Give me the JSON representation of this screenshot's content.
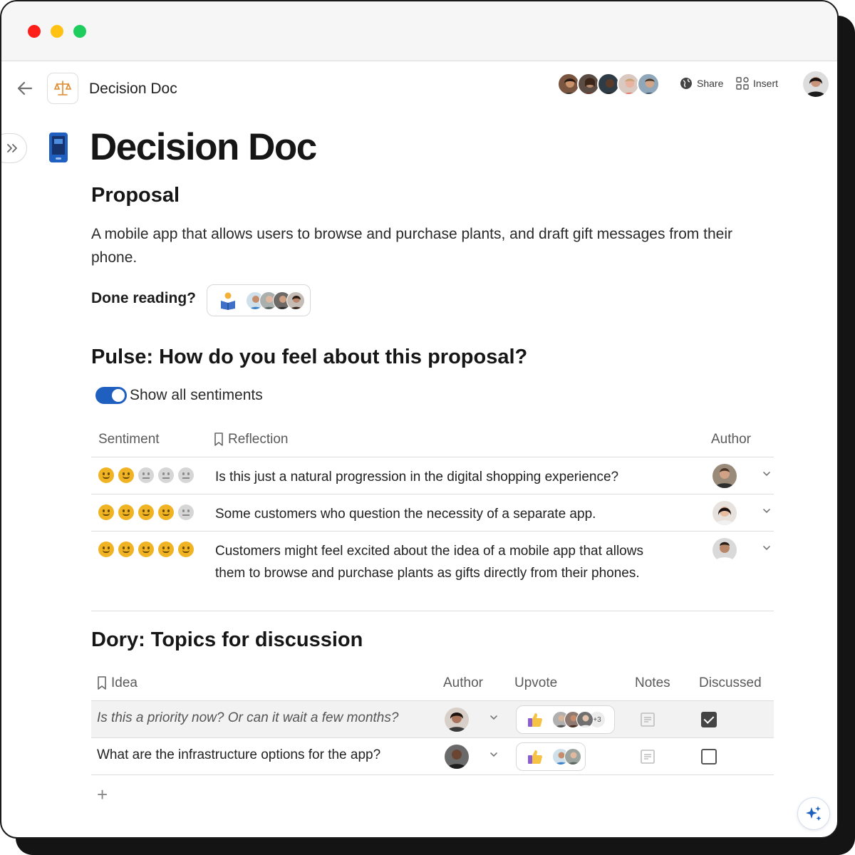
{
  "app": {
    "doc_name": "Decision Doc"
  },
  "toolbar": {
    "share_label": "Share",
    "insert_label": "Insert"
  },
  "colors": {
    "accent": "#1f5fbf",
    "sentiment_on": "#f0b323",
    "sentiment_off": "#d6d6d6",
    "highlight_row": "#f2f2f2"
  },
  "page": {
    "title": "Decision Doc",
    "icon": "mobile-phone-icon"
  },
  "proposal": {
    "heading": "Proposal",
    "text": "A mobile app that allows users to browse and purchase plants, and draft gift messages from their phone.",
    "done_label": "Done reading?"
  },
  "pulse": {
    "heading": "Pulse: How do you feel about this proposal?",
    "toggle_label": "Show all sentiments",
    "toggle_on": true,
    "columns": {
      "sentiment": "Sentiment",
      "reflection": "Reflection",
      "author": "Author"
    },
    "rows": [
      {
        "sentiment": 2,
        "reflection": "Is this just a natural progression in the digital shopping experience?"
      },
      {
        "sentiment": 4,
        "reflection": "Some customers who question the necessity of a separate app."
      },
      {
        "sentiment": 5,
        "reflection": "Customers might feel excited about the idea of a mobile app that allows them to browse and purchase plants as gifts directly from their phones."
      }
    ]
  },
  "dory": {
    "heading": "Dory: Topics for discussion",
    "columns": {
      "idea": "Idea",
      "author": "Author",
      "upvote": "Upvote",
      "notes": "Notes",
      "discussed": "Discussed"
    },
    "rows": [
      {
        "idea": "Is this a priority now? Or can it wait a few months?",
        "upvote_extra": "+3",
        "discussed": true
      },
      {
        "idea": "What are the infrastructure options for the app?",
        "discussed": false
      }
    ],
    "add_label": "+"
  }
}
